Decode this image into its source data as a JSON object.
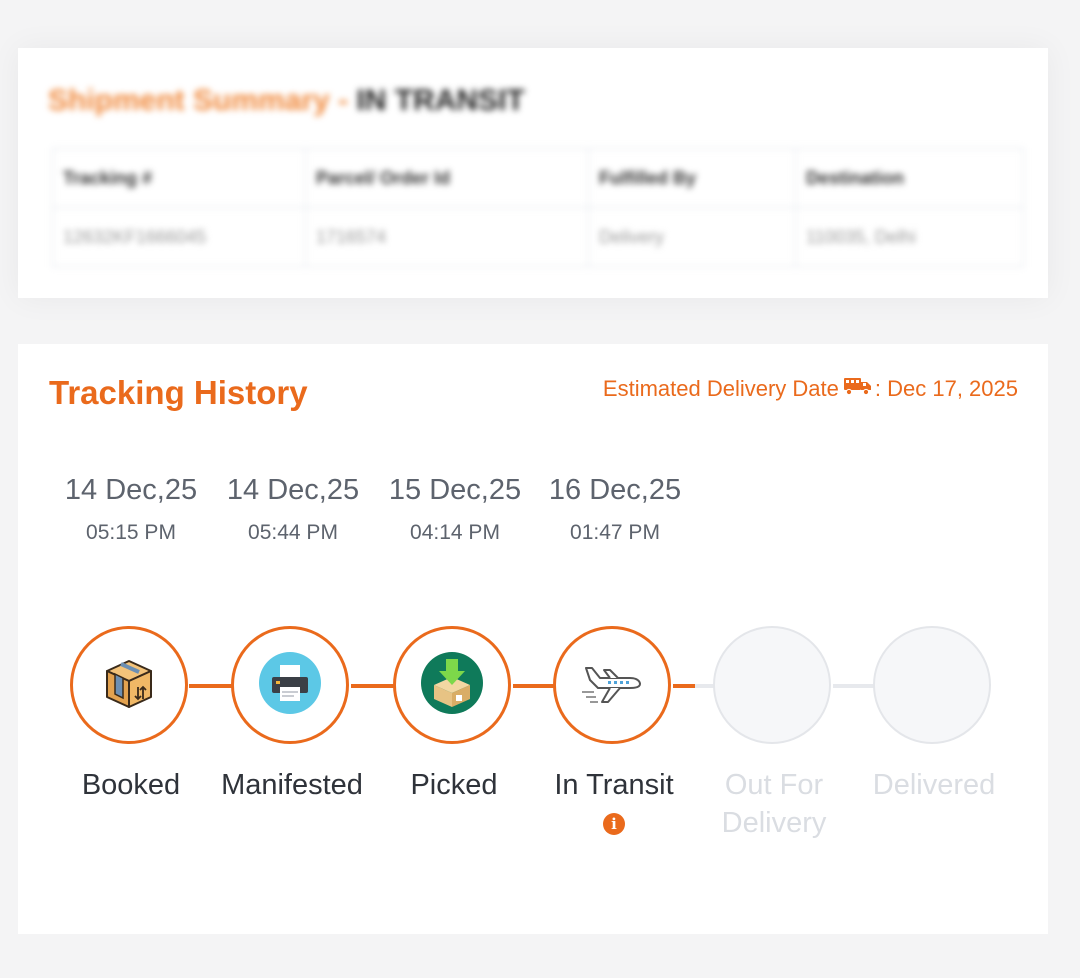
{
  "summary": {
    "title_prefix": "Shipment Summary - ",
    "status": "IN TRANSIT",
    "columns": [
      "Tracking #",
      "Parcel/ Order Id",
      "Fulfilled By",
      "Destination"
    ],
    "row": [
      "12632KF1666045",
      "1716574",
      "Delivery",
      "110035, Delhi"
    ]
  },
  "history": {
    "title": "Tracking History",
    "eta_label": "Estimated Delivery Date",
    "eta_value": ": Dec 17, 2025",
    "steps": [
      {
        "date": "14 Dec,25",
        "time": "05:15 PM",
        "label": "Booked",
        "icon": "box-icon",
        "status": "done"
      },
      {
        "date": "14 Dec,25",
        "time": "05:44 PM",
        "label": "Manifested",
        "icon": "printer-icon",
        "status": "done"
      },
      {
        "date": "15 Dec,25",
        "time": "04:14 PM",
        "label": "Picked",
        "icon": "package-pickup-icon",
        "status": "done"
      },
      {
        "date": "16 Dec,25",
        "time": "01:47 PM",
        "label": "In Transit",
        "icon": "airplane-icon",
        "status": "done"
      },
      {
        "label_line1": "Out For",
        "label_line2": "Delivery",
        "status": "pending"
      },
      {
        "label": "Delivered",
        "status": "pending"
      }
    ],
    "info_icon_text": "i"
  },
  "colors": {
    "accent": "#ea6a1c",
    "pending": "#dadde2",
    "text": "#2f333a"
  }
}
